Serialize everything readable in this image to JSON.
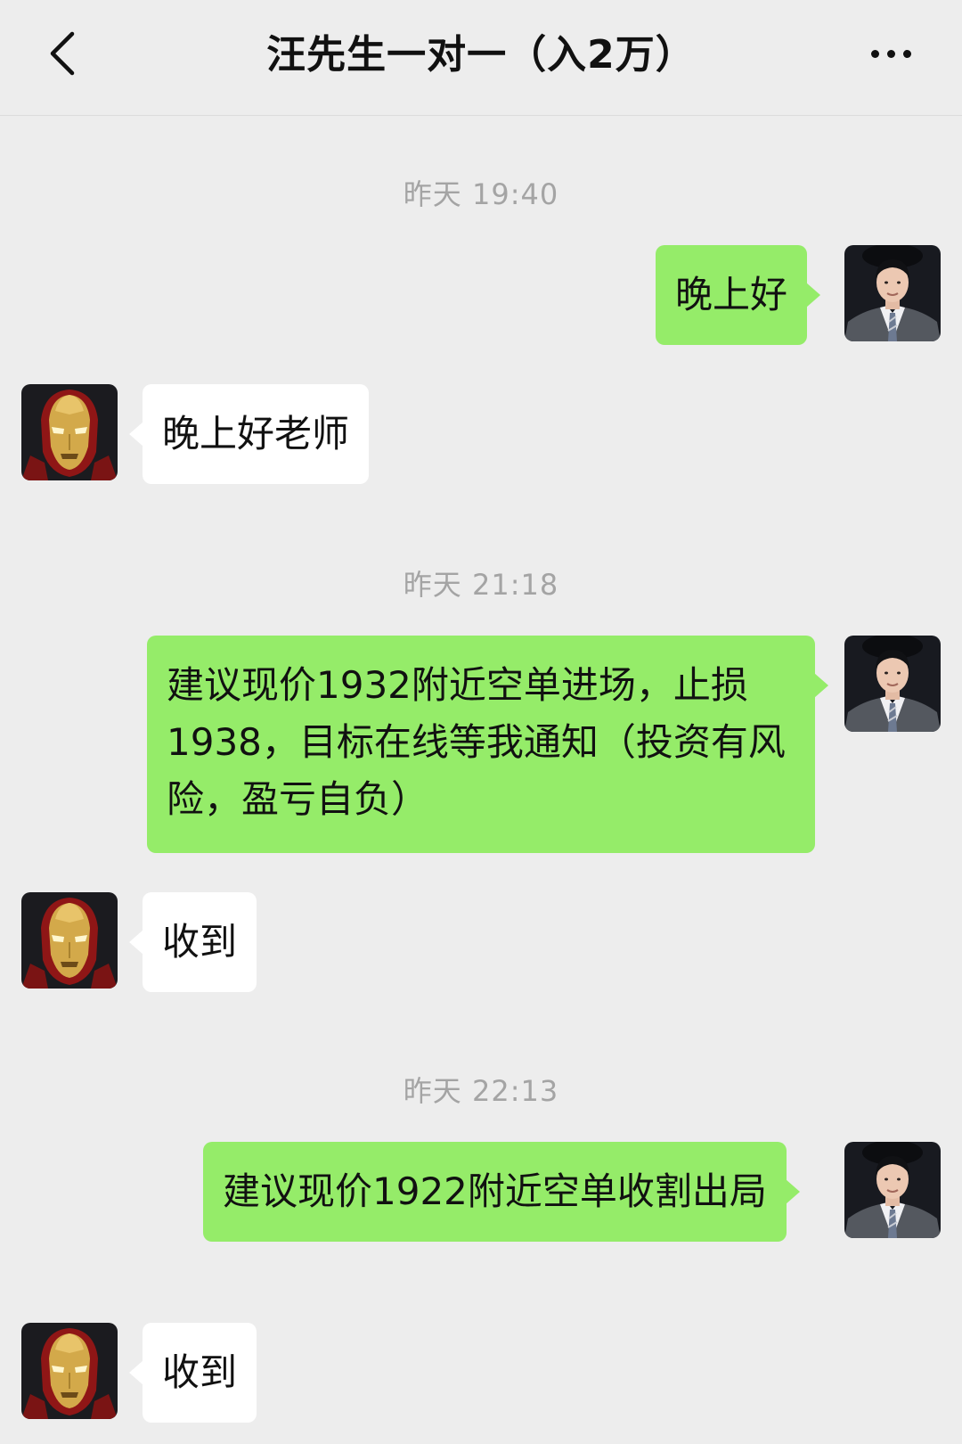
{
  "header": {
    "title": "汪先生一对一（入2万）",
    "back_icon": "chevron-left-icon",
    "more_icon": "more-dots-icon"
  },
  "colors": {
    "background": "#ededed",
    "self_bubble": "#95ec69",
    "other_bubble": "#ffffff",
    "timestamp_text": "#a4a4a4"
  },
  "messages": [
    {
      "type": "time",
      "text": "昨天 19:40"
    },
    {
      "type": "msg",
      "sender": "self",
      "text": "晚上好"
    },
    {
      "type": "msg",
      "sender": "other",
      "text": "晚上好老师"
    },
    {
      "type": "time",
      "text": "昨天 21:18"
    },
    {
      "type": "msg",
      "sender": "self",
      "text": "建议现价1932附近空单进场，止损1938，目标在线等我通知（投资有风险，盈亏自负）"
    },
    {
      "type": "msg",
      "sender": "other",
      "text": "收到"
    },
    {
      "type": "time",
      "text": "昨天 22:13"
    },
    {
      "type": "msg",
      "sender": "self",
      "text": "建议现价1922附近空单收割出局"
    },
    {
      "type": "msg",
      "sender": "other",
      "text": "收到"
    }
  ]
}
